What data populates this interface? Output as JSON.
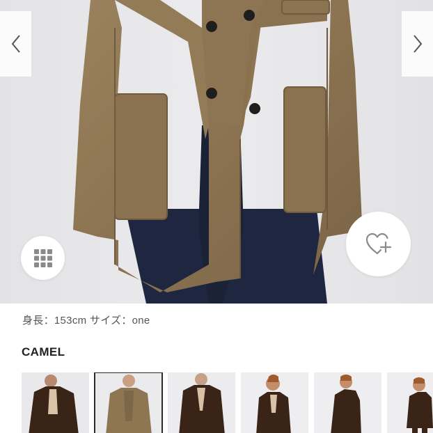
{
  "product": {
    "model_info": "身長：153cm サイズ：one",
    "color_label": "CAMEL"
  },
  "icons": {
    "prev": "chevron-left-icon",
    "next": "chevron-right-icon",
    "grid": "grid-icon",
    "favorite": "heart-plus-icon"
  },
  "colors": {
    "camel": "#8e7653",
    "dark_brown": "#3a2418",
    "denim": "#1f2740",
    "icon_gray": "#8a8a8a"
  },
  "thumbnails": [
    {
      "label": "dark-brown",
      "selected": false
    },
    {
      "label": "camel",
      "selected": true
    },
    {
      "label": "dark-brown",
      "selected": false
    },
    {
      "label": "dark-brown",
      "selected": false
    },
    {
      "label": "dark-brown",
      "selected": false
    },
    {
      "label": "dark-brown",
      "selected": false
    }
  ]
}
